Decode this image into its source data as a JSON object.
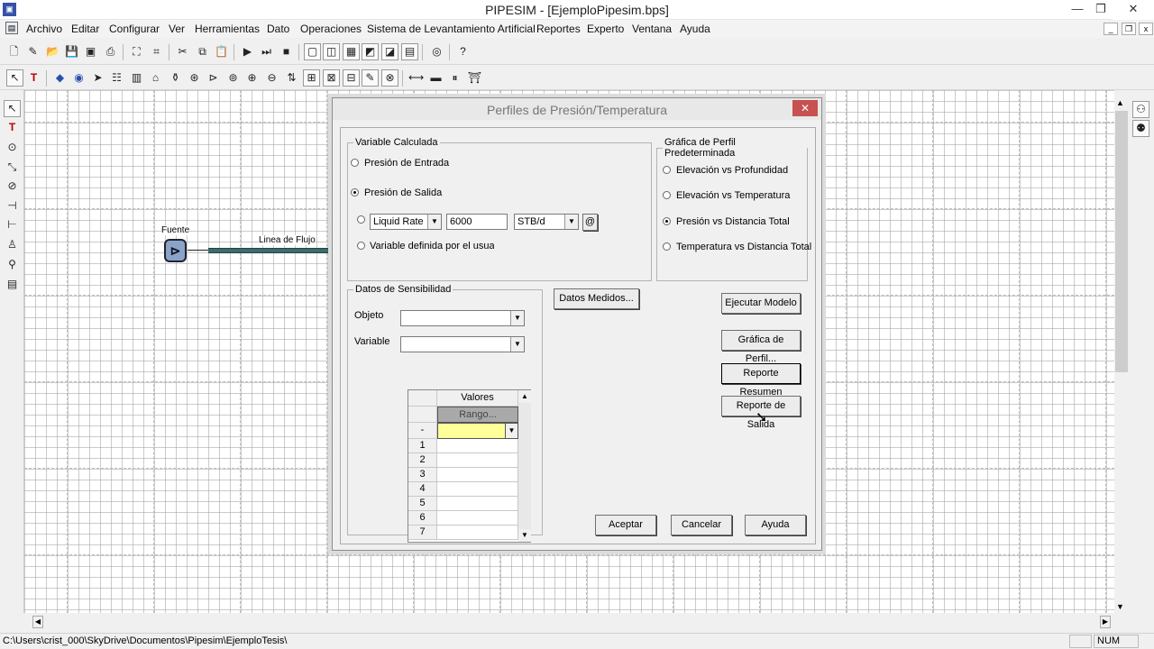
{
  "window": {
    "title": "PIPESIM - [EjemploPipesim.bps]",
    "min": "—",
    "max": "❐",
    "close": "✕"
  },
  "menu": [
    "Archivo",
    "Editar",
    "Configurar",
    "Ver",
    "Herramientas",
    "Dato",
    "Operaciones",
    "Sistema de Levantamiento Artificial",
    "Reportes",
    "Experto",
    "Ventana",
    "Ayuda"
  ],
  "mdi": {
    "min": "_",
    "restore": "❐",
    "close": "x"
  },
  "canvas": {
    "node_label": "Fuente",
    "line_label": "Linea de Flujo"
  },
  "dialog": {
    "title": "Perfiles de Presión/Temperatura",
    "close": "✕",
    "variable_group": "Variable Calculada",
    "radio_entrada": "Presión de Entrada",
    "radio_salida": "Presión de Salida",
    "flow_var": "Liquid Rate",
    "flow_value": "6000",
    "flow_unit": "STB/d",
    "at_button": "@",
    "radio_user": "Variable definida por el usuario",
    "profile_group": "Gráfica de Perfil Predeterminada",
    "profile_options": [
      "Elevación vs Profundidad",
      "Elevación vs Temperatura",
      "Presión vs Distancia Total",
      "Temperatura vs Distancia Total"
    ],
    "sens_group": "Datos de Sensibilidad",
    "objeto_label": "Objeto",
    "variable_label": "Variable",
    "grid_header": "Valores",
    "grid_range": "Rango...",
    "grid_dash": "-",
    "grid_rows": [
      "1",
      "2",
      "3",
      "4",
      "5",
      "6",
      "7"
    ],
    "buttons": {
      "datos": "Datos Medidos...",
      "ejecutar": "Ejecutar Modelo",
      "grafica": "Gráfica de Perfil...",
      "resumen": "Reporte Resumen",
      "salida": "Reporte de Salida",
      "aceptar": "Aceptar",
      "cancelar": "Cancelar",
      "ayuda": "Ayuda"
    }
  },
  "status": {
    "path": "C:\\Users\\crist_000\\SkyDrive\\Documentos\\Pipesim\\EjemploTesis\\",
    "num": "NUM"
  },
  "colors": {
    "accent": "#c75050",
    "pipe": "#3d6b6b",
    "grid_highlight": "#ffff99"
  }
}
